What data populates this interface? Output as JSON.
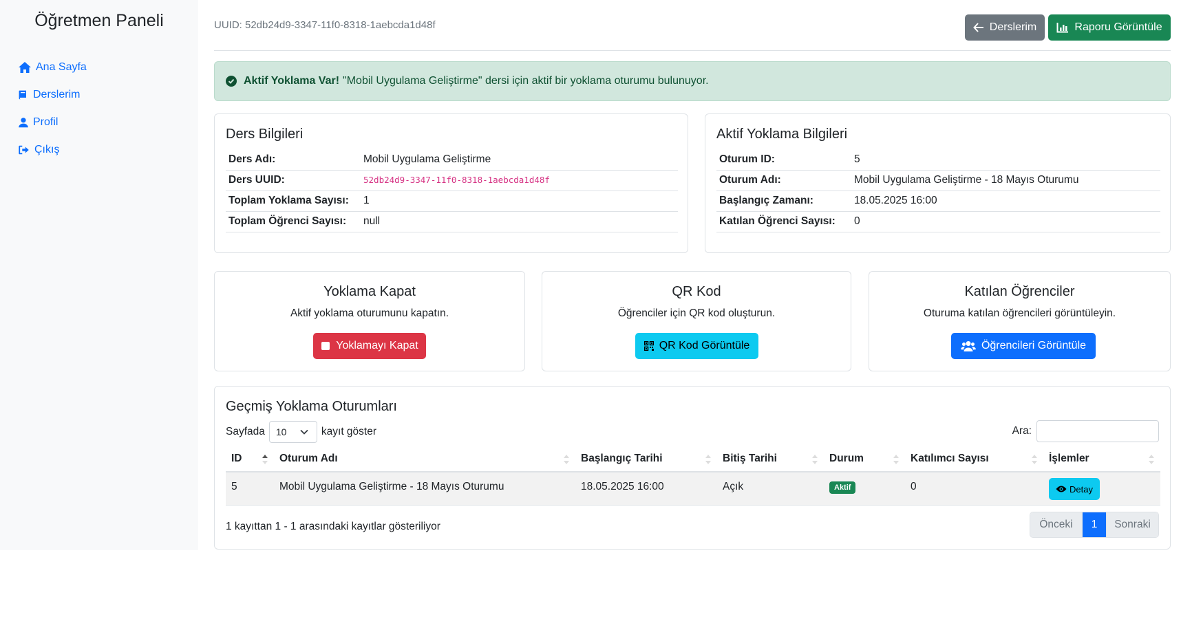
{
  "sidebar": {
    "title": "Öğretmen Paneli",
    "items": [
      {
        "label": "Ana Sayfa",
        "icon": "home-icon"
      },
      {
        "label": "Derslerim",
        "icon": "book-icon"
      },
      {
        "label": "Profil",
        "icon": "user-icon"
      },
      {
        "label": "Çıkış",
        "icon": "sign-out-icon"
      }
    ]
  },
  "header": {
    "uuid_text": "UUID: 52db24d9-3347-11f0-8318-1aebcda1d48f",
    "back_button": "Derslerim",
    "report_button": "Raporu Görüntüle"
  },
  "alert": {
    "strong": "Aktif Yoklama Var!",
    "text": "\"Mobil Uygulama Geliştirme\" dersi için aktif bir yoklama oturumu bulunuyor."
  },
  "course_info": {
    "title": "Ders Bilgileri",
    "rows": [
      {
        "key": "Ders Adı:",
        "value": "Mobil Uygulama Geliştirme"
      },
      {
        "key": "Ders UUID:",
        "value": "52db24d9-3347-11f0-8318-1aebcda1d48f"
      },
      {
        "key": "Toplam Yoklama Sayısı:",
        "value": "1"
      },
      {
        "key": "Toplam Öğrenci Sayısı:",
        "value": "null"
      }
    ]
  },
  "active_info": {
    "title": "Aktif Yoklama Bilgileri",
    "rows": [
      {
        "key": "Oturum ID:",
        "value": "5"
      },
      {
        "key": "Oturum Adı:",
        "value": "Mobil Uygulama Geliştirme - 18 Mayıs Oturumu"
      },
      {
        "key": "Başlangıç Zamanı:",
        "value": "18.05.2025 16:00"
      },
      {
        "key": "Katılan Öğrenci Sayısı:",
        "value": "0"
      }
    ]
  },
  "actions": {
    "close": {
      "title": "Yoklama Kapat",
      "desc": "Aktif yoklama oturumunu kapatın.",
      "button": "Yoklamayı Kapat"
    },
    "qr": {
      "title": "QR Kod",
      "desc": "Öğrenciler için QR kod oluşturun.",
      "button": "QR Kod Görüntüle"
    },
    "students": {
      "title": "Katılan Öğrenciler",
      "desc": "Oturuma katılan öğrencileri görüntüleyin.",
      "button": "Öğrencileri Görüntüle"
    }
  },
  "history": {
    "title": "Geçmiş Yoklama Oturumları",
    "length_prefix": "Sayfada",
    "length_value": "10",
    "length_suffix": "kayıt göster",
    "search_label": "Ara:",
    "columns": [
      "ID",
      "Oturum Adı",
      "Başlangıç Tarihi",
      "Bitiş Tarihi",
      "Durum",
      "Katılımcı Sayısı",
      "İşlemler"
    ],
    "rows": [
      {
        "id": "5",
        "name": "Mobil Uygulama Geliştirme - 18 Mayıs Oturumu",
        "start": "18.05.2025 16:00",
        "end": "Açık",
        "status": "Aktif",
        "count": "0",
        "action": "Detay"
      }
    ],
    "info": "1 kayıttan 1 - 1 arasındaki kayıtlar gösteriliyor",
    "pager": {
      "prev": "Önceki",
      "current": "1",
      "next": "Sonraki"
    }
  },
  "colors": {
    "primary": "#0d6efd",
    "success": "#198754",
    "danger": "#dc3545",
    "info": "#0dcaf0",
    "secondary": "#6c757d",
    "alert_bg": "#d1e7dd"
  }
}
